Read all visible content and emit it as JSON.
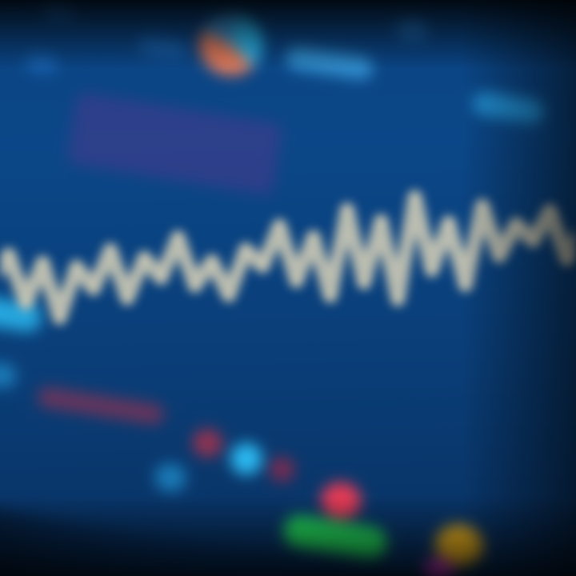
{
  "screen": {
    "description_colors": {
      "background": "#0a3f7c",
      "accent_cyan": "#2bb8f0",
      "accent_green": "#22d65a",
      "accent_red": "#e23a55",
      "accent_yellow": "#e8b020",
      "accent_magenta": "#c43cc8",
      "line_color": "#d9d2b8"
    }
  },
  "header": {
    "icons": [
      "app-logo-icon",
      "status-green-icon",
      "pie-chart-icon"
    ]
  },
  "chart_data": {
    "type": "line",
    "x": [
      0,
      1,
      2,
      3,
      4,
      5,
      6,
      7,
      8,
      9,
      10,
      11,
      12,
      13,
      14,
      15,
      16,
      17,
      18,
      19,
      20,
      21,
      22,
      23,
      24,
      25,
      26,
      27,
      28,
      29,
      30,
      31,
      32,
      33,
      34,
      35
    ],
    "series": [
      {
        "values": [
          55,
          68,
          40,
          62,
          30,
          58,
          45,
          66,
          38,
          60,
          48,
          70,
          42,
          55,
          35,
          60,
          50,
          72,
          40,
          64,
          30,
          78,
          36,
          70,
          25,
          82,
          40,
          66,
          30,
          74,
          45,
          62,
          52,
          68,
          40,
          58
        ]
      }
    ],
    "ylim": [
      0,
      100
    ],
    "grid": false
  }
}
